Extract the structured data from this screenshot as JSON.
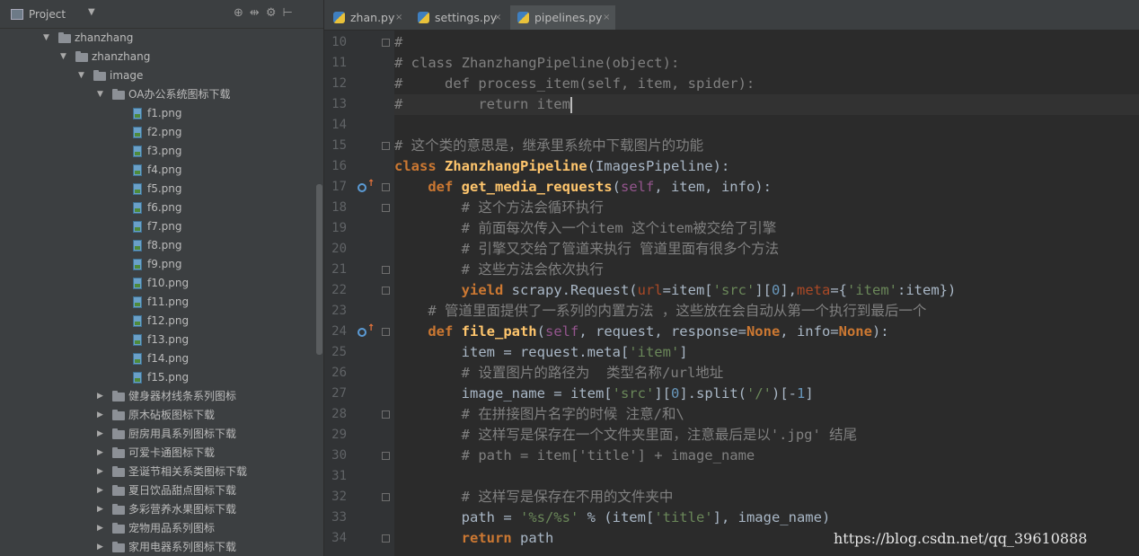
{
  "project_panel": {
    "title": "Project",
    "dropdown_arrow": "▼",
    "tool_icons": [
      "⊕",
      "⇹",
      "⚙",
      "⊢"
    ],
    "tree": [
      {
        "depth": 0,
        "type": "folder",
        "open": true,
        "label": "zhanzhang"
      },
      {
        "depth": 1,
        "type": "folder",
        "open": true,
        "label": "zhanzhang"
      },
      {
        "depth": 2,
        "type": "folder",
        "open": true,
        "label": "image"
      },
      {
        "depth": 3,
        "type": "folder",
        "open": true,
        "label": "OA办公系统图标下载"
      },
      {
        "depth": 4,
        "type": "file",
        "label": "f1.png"
      },
      {
        "depth": 4,
        "type": "file",
        "label": "f2.png"
      },
      {
        "depth": 4,
        "type": "file",
        "label": "f3.png"
      },
      {
        "depth": 4,
        "type": "file",
        "label": "f4.png"
      },
      {
        "depth": 4,
        "type": "file",
        "label": "f5.png"
      },
      {
        "depth": 4,
        "type": "file",
        "label": "f6.png"
      },
      {
        "depth": 4,
        "type": "file",
        "label": "f7.png"
      },
      {
        "depth": 4,
        "type": "file",
        "label": "f8.png"
      },
      {
        "depth": 4,
        "type": "file",
        "label": "f9.png"
      },
      {
        "depth": 4,
        "type": "file",
        "label": "f10.png"
      },
      {
        "depth": 4,
        "type": "file",
        "label": "f11.png"
      },
      {
        "depth": 4,
        "type": "file",
        "label": "f12.png"
      },
      {
        "depth": 4,
        "type": "file",
        "label": "f13.png"
      },
      {
        "depth": 4,
        "type": "file",
        "label": "f14.png"
      },
      {
        "depth": 4,
        "type": "file",
        "label": "f15.png"
      },
      {
        "depth": 3,
        "type": "folder",
        "open": false,
        "label": "健身器材线条系列图标"
      },
      {
        "depth": 3,
        "type": "folder",
        "open": false,
        "label": "原木砧板图标下载"
      },
      {
        "depth": 3,
        "type": "folder",
        "open": false,
        "label": "厨房用具系列图标下载"
      },
      {
        "depth": 3,
        "type": "folder",
        "open": false,
        "label": "可爱卡通图标下载"
      },
      {
        "depth": 3,
        "type": "folder",
        "open": false,
        "label": "圣诞节相关系类图标下载"
      },
      {
        "depth": 3,
        "type": "folder",
        "open": false,
        "label": "夏日饮品甜点图标下载"
      },
      {
        "depth": 3,
        "type": "folder",
        "open": false,
        "label": "多彩营养水果图标下载"
      },
      {
        "depth": 3,
        "type": "folder",
        "open": false,
        "label": "宠物用品系列图标"
      },
      {
        "depth": 3,
        "type": "folder",
        "open": false,
        "label": "家用电器系列图标下载"
      }
    ]
  },
  "tabs": [
    {
      "name": "zhan.py",
      "active": false
    },
    {
      "name": "settings.py",
      "active": false
    },
    {
      "name": "pipelines.py",
      "active": true
    }
  ],
  "tab_close": "×",
  "editor": {
    "lines": [
      {
        "n": "10",
        "fold": true,
        "tokens": [
          [
            "cm",
            "#"
          ]
        ]
      },
      {
        "n": "11",
        "tokens": [
          [
            "cm",
            "# class ZhanzhangPipeline(object):"
          ]
        ]
      },
      {
        "n": "12",
        "tokens": [
          [
            "cm",
            "#     def process_item(self, item, spider):"
          ]
        ]
      },
      {
        "n": "13",
        "caret": true,
        "tokens": [
          [
            "cm",
            "#         return item"
          ]
        ]
      },
      {
        "n": "14",
        "tokens": []
      },
      {
        "n": "15",
        "fold": true,
        "tokens": [
          [
            "cm",
            "# 这个类的意思是，继承里系统中下载图片的功能"
          ]
        ]
      },
      {
        "n": "16",
        "tokens": [
          [
            "kw",
            "class "
          ],
          [
            "fn",
            "ZhanzhangPipeline"
          ],
          [
            "tx",
            "(ImagesPipeline):"
          ]
        ]
      },
      {
        "n": "17",
        "fold": true,
        "override": true,
        "tokens": [
          [
            "tx",
            "    "
          ],
          [
            "kw",
            "def "
          ],
          [
            "fn",
            "get_media_requests"
          ],
          [
            "tx",
            "("
          ],
          [
            "sf",
            "self"
          ],
          [
            "tx",
            ", item, info):"
          ]
        ]
      },
      {
        "n": "18",
        "fold": true,
        "tokens": [
          [
            "tx",
            "        "
          ],
          [
            "cm",
            "# 这个方法会循环执行"
          ]
        ]
      },
      {
        "n": "19",
        "tokens": [
          [
            "tx",
            "        "
          ],
          [
            "cm",
            "# 前面每次传入一个item 这个item被交给了引擎"
          ]
        ]
      },
      {
        "n": "20",
        "tokens": [
          [
            "tx",
            "        "
          ],
          [
            "cm",
            "# 引擎又交给了管道来执行 管道里面有很多个方法"
          ]
        ]
      },
      {
        "n": "21",
        "fold": true,
        "tokens": [
          [
            "tx",
            "        "
          ],
          [
            "cm",
            "# 这些方法会依次执行"
          ]
        ]
      },
      {
        "n": "22",
        "fold": true,
        "tokens": [
          [
            "tx",
            "        "
          ],
          [
            "kw",
            "yield "
          ],
          [
            "tx",
            "scrapy.Request("
          ],
          [
            "kp",
            "url"
          ],
          [
            "tx",
            "=item["
          ],
          [
            "st",
            "'src'"
          ],
          [
            "tx",
            "]["
          ],
          [
            "nm",
            "0"
          ],
          [
            "tx",
            "],"
          ],
          [
            "kp",
            "meta"
          ],
          [
            "tx",
            "={"
          ],
          [
            "st",
            "'item'"
          ],
          [
            "tx",
            ":item})"
          ]
        ]
      },
      {
        "n": "23",
        "tokens": [
          [
            "tx",
            "    "
          ],
          [
            "cm",
            "# 管道里面提供了一系列的内置方法 ，这些放在会自动从第一个执行到最后一个"
          ]
        ]
      },
      {
        "n": "24",
        "fold": true,
        "override": true,
        "tokens": [
          [
            "tx",
            "    "
          ],
          [
            "kw",
            "def "
          ],
          [
            "fn",
            "file_path"
          ],
          [
            "tx",
            "("
          ],
          [
            "sf",
            "self"
          ],
          [
            "tx",
            ", request, response="
          ],
          [
            "kw",
            "None"
          ],
          [
            "tx",
            ", info="
          ],
          [
            "kw",
            "None"
          ],
          [
            "tx",
            "):"
          ]
        ]
      },
      {
        "n": "25",
        "tokens": [
          [
            "tx",
            "        item = request.meta["
          ],
          [
            "st",
            "'item'"
          ],
          [
            "tx",
            "]"
          ]
        ]
      },
      {
        "n": "26",
        "tokens": [
          [
            "tx",
            "        "
          ],
          [
            "cm",
            "# 设置图片的路径为  类型名称/url地址"
          ]
        ]
      },
      {
        "n": "27",
        "tokens": [
          [
            "tx",
            "        image_name = item["
          ],
          [
            "st",
            "'src'"
          ],
          [
            "tx",
            "]["
          ],
          [
            "nm",
            "0"
          ],
          [
            "tx",
            "].split("
          ],
          [
            "st",
            "'/'"
          ],
          [
            "tx",
            ")[-"
          ],
          [
            "nm",
            "1"
          ],
          [
            "tx",
            "]"
          ]
        ]
      },
      {
        "n": "28",
        "fold": true,
        "tokens": [
          [
            "tx",
            "        "
          ],
          [
            "cm",
            "# 在拼接图片名字的时候 注意/和\\"
          ]
        ]
      },
      {
        "n": "29",
        "tokens": [
          [
            "tx",
            "        "
          ],
          [
            "cm",
            "# 这样写是保存在一个文件夹里面，注意最后是以'.jpg' 结尾"
          ]
        ]
      },
      {
        "n": "30",
        "fold": true,
        "tokens": [
          [
            "tx",
            "        "
          ],
          [
            "cm",
            "# path = item['title'] + image_name"
          ]
        ]
      },
      {
        "n": "31",
        "tokens": []
      },
      {
        "n": "32",
        "fold": true,
        "tokens": [
          [
            "tx",
            "        "
          ],
          [
            "cm",
            "# 这样写是保存在不用的文件夹中"
          ]
        ]
      },
      {
        "n": "33",
        "tokens": [
          [
            "tx",
            "        path = "
          ],
          [
            "st",
            "'%s/%s'"
          ],
          [
            "tx",
            " % (item["
          ],
          [
            "st",
            "'title'"
          ],
          [
            "tx",
            "], image_name)"
          ]
        ]
      },
      {
        "n": "34",
        "fold": true,
        "tokens": [
          [
            "tx",
            "        "
          ],
          [
            "kw",
            "return "
          ],
          [
            "tx",
            "path"
          ]
        ]
      }
    ]
  },
  "watermark": "https://blog.csdn.net/qq_39610888",
  "colors": {
    "keyword": "#cc7832",
    "function": "#ffc66d",
    "comment": "#808080",
    "string": "#6a8759",
    "number": "#6897bb",
    "self": "#94558d",
    "text": "#a9b7c6"
  }
}
